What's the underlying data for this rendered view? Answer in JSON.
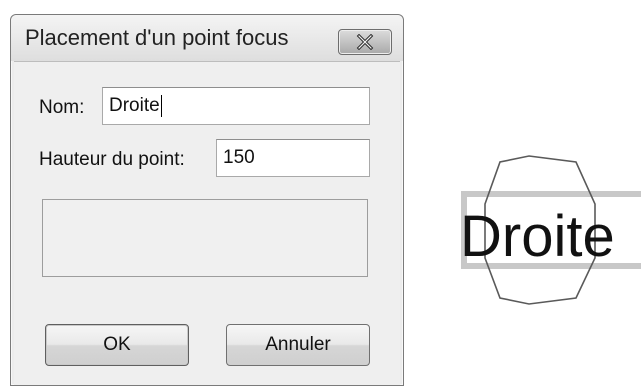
{
  "dialog": {
    "title": "Placement d'un point focus",
    "close_icon": "close-icon",
    "name_label": "Nom:",
    "name_value": "Droite",
    "height_label": "Hauteur du point:",
    "height_value": "150",
    "ok_label": "OK",
    "cancel_label": "Annuler"
  },
  "preview": {
    "label": "Droite"
  }
}
